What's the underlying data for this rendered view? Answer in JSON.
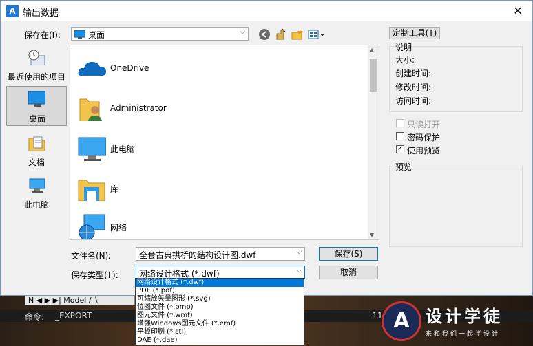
{
  "dialog": {
    "title": "输出数据",
    "app_icon_text": "A",
    "close": "✕"
  },
  "save_in": {
    "label": "保存在(I):",
    "value": "桌面"
  },
  "places": [
    {
      "label": "最近使用的项目"
    },
    {
      "label": "桌面"
    },
    {
      "label": "文档"
    },
    {
      "label": "此电脑"
    }
  ],
  "files": [
    {
      "name": "OneDrive"
    },
    {
      "name": "Administrator"
    },
    {
      "name": "此电脑"
    },
    {
      "name": "库"
    },
    {
      "name": "网络"
    }
  ],
  "filename": {
    "label": "文件名(N):",
    "value": "全套古典拱桥的结构设计图.dwf"
  },
  "filetype": {
    "label": "保存类型(T):",
    "value": "网络设计格式 (*.dwf)"
  },
  "buttons": {
    "save": "保存(S)",
    "cancel": "取消",
    "tools": "定制工具(T)"
  },
  "info": {
    "title": "说明",
    "size": "大小:",
    "created": "创建时间:",
    "modified": "修改时间:",
    "accessed": "访问时间:"
  },
  "options": {
    "readonly": "只读打开",
    "password": "密码保护",
    "preview": "使用预览",
    "preview_checked": "✓"
  },
  "preview": {
    "title": "预览"
  },
  "filetype_options": [
    "网络设计格式 (*.dwf)",
    "PDF (*.pdf)",
    "可缩放矢量图形 (*.svg)",
    "位图文件 (*.bmp)",
    "图元文件 (*.wmf)",
    "增强Windows图元文件 (*.emf)",
    "平板印刷 (*.stl)",
    "DAE (*.dae)"
  ],
  "background": {
    "cmd_prompt": "命令:",
    "cmd_text": "_EXPORT",
    "coords": "-11.        6.        0.",
    "tab_text": "N ◀ ▶ ▶| Model / ∖",
    "watermark_title": "设计学徒",
    "watermark_sub": "来和我们一起学设计",
    "watermark_logo": "A"
  }
}
